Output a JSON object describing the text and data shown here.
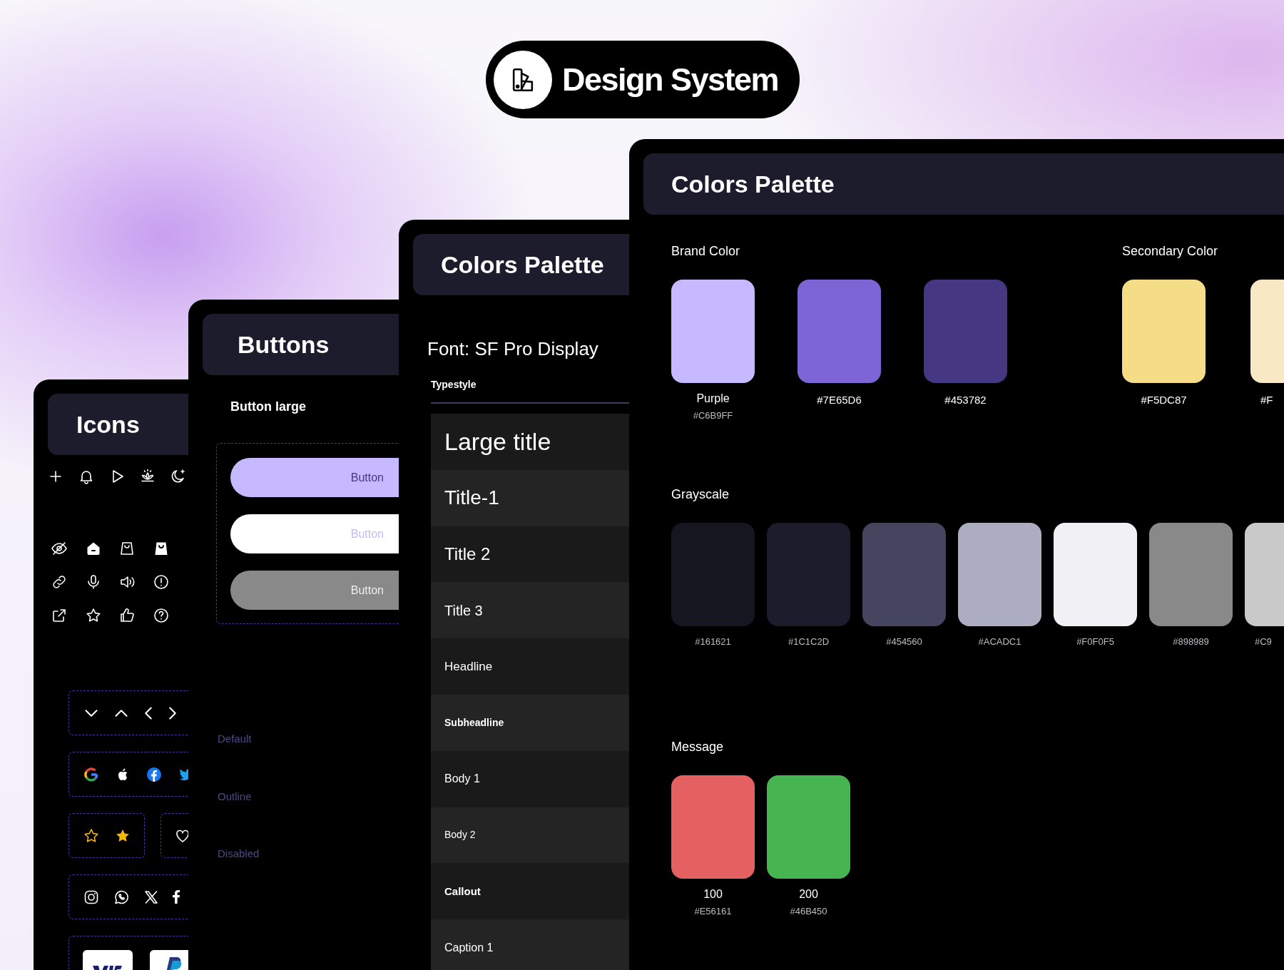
{
  "header": {
    "title": "Design System"
  },
  "panels": [
    {
      "kind": "icons",
      "title": "Icons"
    },
    {
      "kind": "buttons",
      "title": "Buttons",
      "subtitle": "Button large",
      "buttons": [
        {
          "label": "Button",
          "kind": "default"
        },
        {
          "label": "Button",
          "kind": "outline"
        },
        {
          "label": "Button",
          "kind": "disabled"
        }
      ],
      "state_labels": [
        "Default",
        "Outline",
        "Disabled"
      ]
    },
    {
      "kind": "typography",
      "title": "Colors Palette",
      "font": "Font: SF Pro Display",
      "column": "Typestyle",
      "styles": [
        {
          "label": "Large title",
          "kind": "large-title"
        },
        {
          "label": "Title-1",
          "kind": "title-1"
        },
        {
          "label": "Title 2",
          "kind": "title-2"
        },
        {
          "label": "Title 3",
          "kind": "title-3"
        },
        {
          "label": "Headline",
          "kind": "headline"
        },
        {
          "label": "Subheadline",
          "kind": "subheadline"
        },
        {
          "label": "Body 1",
          "kind": "body-1"
        },
        {
          "label": "Body 2",
          "kind": "body-2"
        },
        {
          "label": "Callout",
          "kind": "callout"
        },
        {
          "label": "Caption 1",
          "kind": "caption-1"
        }
      ]
    },
    {
      "kind": "palette",
      "title": "Colors Palette",
      "groups": [
        {
          "title": "Brand Color",
          "swatches": [
            {
              "name": "Purple",
              "hex": "#C6B9FF",
              "color": "#c6b9ff"
            },
            {
              "hex": "#7E65D6",
              "color": "#7e65d6"
            },
            {
              "hex": "#453782",
              "color": "#453782"
            }
          ]
        },
        {
          "title": "Secondary Color",
          "swatches": [
            {
              "hex": "#F5DC87",
              "color": "#f5dc87"
            },
            {
              "hex": "#F",
              "color": "#f9e8c4"
            }
          ]
        },
        {
          "title": "Grayscale",
          "swatches": [
            {
              "hex": "#161621",
              "color": "#161621"
            },
            {
              "hex": "#1C1C2D",
              "color": "#1c1c2d"
            },
            {
              "hex": "#454560",
              "color": "#454560"
            },
            {
              "hex": "#ACADC1",
              "color": "#acadc1"
            },
            {
              "hex": "#F0F0F5",
              "color": "#f0f0f5"
            },
            {
              "hex": "#898989",
              "color": "#898989"
            },
            {
              "hex": "#C9",
              "color": "#c9c9c9"
            }
          ]
        },
        {
          "title": "Message",
          "swatches": [
            {
              "name": "100",
              "hex": "#E56161",
              "color": "#e56161"
            },
            {
              "name": "200",
              "hex": "#46B450",
              "color": "#46b450"
            }
          ]
        }
      ]
    }
  ]
}
